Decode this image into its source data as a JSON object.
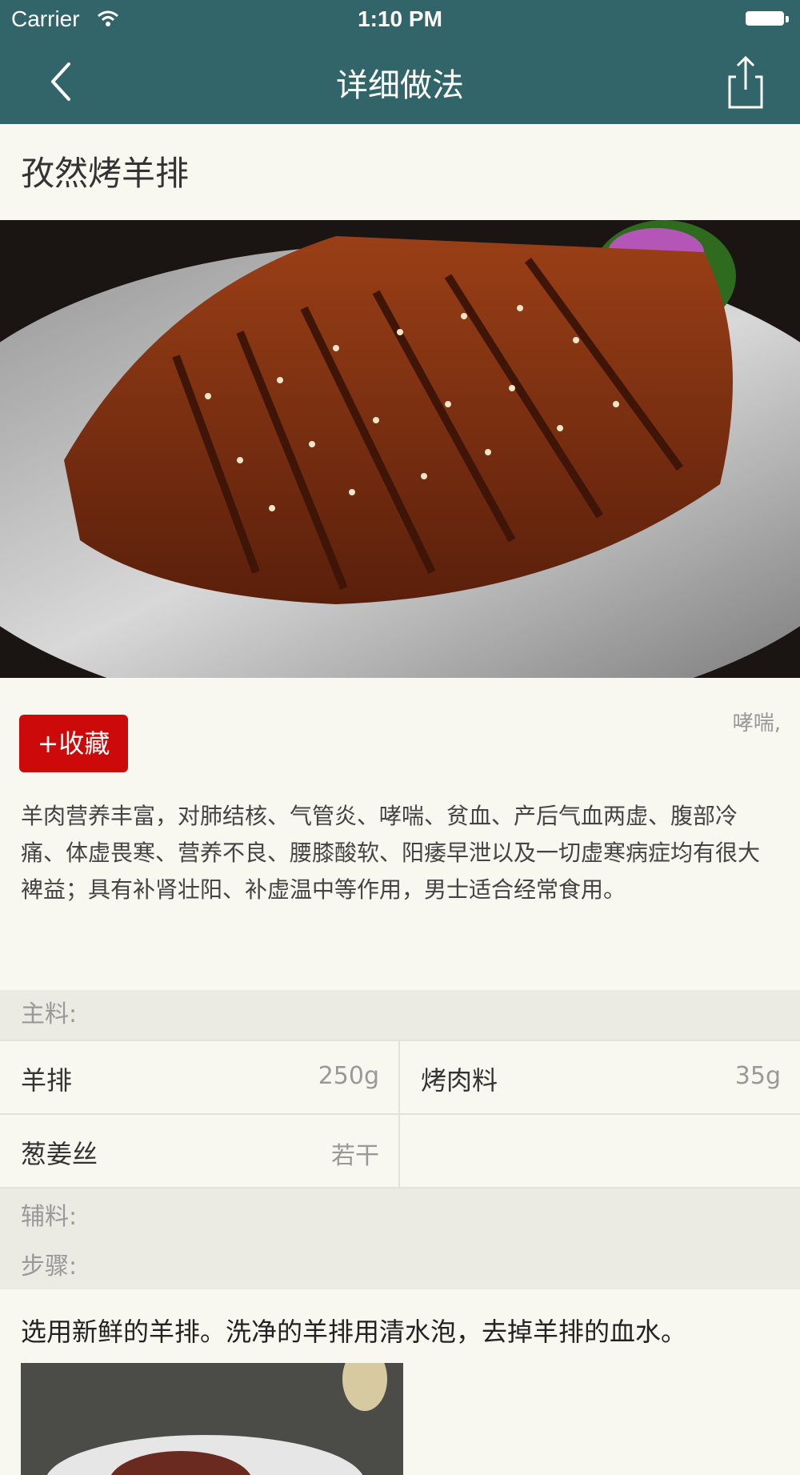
{
  "status_bar": {
    "carrier": "Carrier",
    "time": "1:10 PM"
  },
  "nav": {
    "title": "详细做法",
    "back_icon": "chevron-left-icon",
    "share_icon": "share-icon"
  },
  "recipe": {
    "title": "孜然烤羊排",
    "favorite_label": "+收藏",
    "tag": "哮喘,",
    "description": "羊肉营养丰富，对肺结核、气管炎、哮喘、贫血、产后气血两虚、腹部冷痛、体虚畏寒、营养不良、腰膝酸软、阳痿早泄以及一切虚寒病症均有很大裨益；具有补肾壮阳、补虚温中等作用，男士适合经常食用。"
  },
  "ingredients": {
    "main_label": "主料:",
    "main": [
      {
        "name": "羊排",
        "qty": "250g"
      },
      {
        "name": "烤肉料",
        "qty": "35g"
      },
      {
        "name": "葱姜丝",
        "qty": "若干"
      },
      {
        "name": "",
        "qty": ""
      }
    ],
    "aux_label": "辅料:",
    "steps_label": "步骤:"
  },
  "steps": [
    {
      "text": "选用新鲜的羊排。洗净的羊排用清水泡，去掉羊排的血水。"
    }
  ],
  "colors": {
    "nav_bg": "#316569",
    "accent_red": "#cc0a0a",
    "page_bg": "#f8f7f0"
  }
}
